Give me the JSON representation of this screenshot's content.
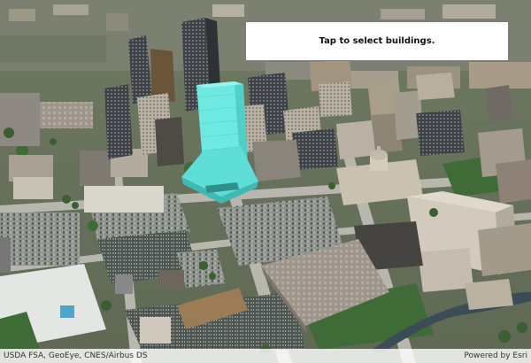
{
  "overlay": {
    "instruction_text": "Tap to select buildings."
  },
  "attribution": {
    "sources_text": "USDA FSA, GeoEye, CNES/Airbus DS",
    "powered_by_text": "Powered by Esri"
  },
  "scene": {
    "selected_building_color": "#5ee6e0",
    "selected_building_name": "selected-building"
  }
}
